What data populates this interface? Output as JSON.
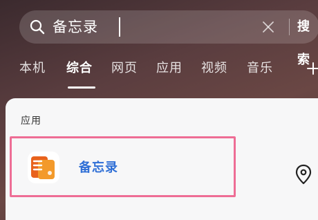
{
  "search": {
    "query": "备忘录",
    "submit_label": "搜索"
  },
  "tabs": [
    {
      "label": "本机"
    },
    {
      "label": "综合"
    },
    {
      "label": "网页"
    },
    {
      "label": "应用"
    },
    {
      "label": "视频"
    },
    {
      "label": "音乐"
    }
  ],
  "active_tab": "综合",
  "results": {
    "section_title": "应用",
    "app": {
      "name": "备忘录",
      "icon": "notes-app-icon"
    }
  },
  "colors": {
    "highlight_border": "#ee6d95",
    "app_name": "#2f6fd6",
    "app_icon_orange": "#f39a2b"
  }
}
